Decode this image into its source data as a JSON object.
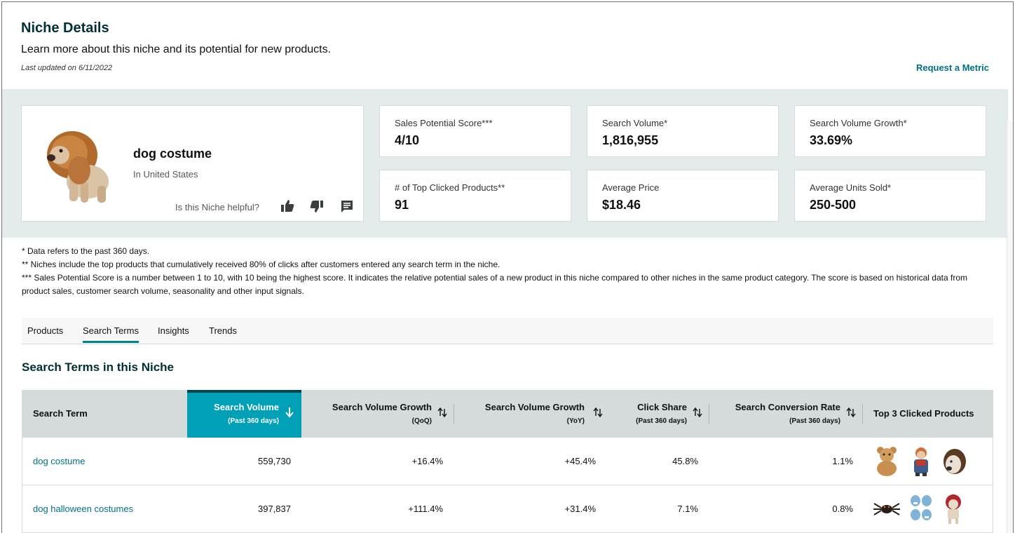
{
  "header": {
    "title": "Niche Details",
    "subtitle": "Learn more about this niche and its potential for new products.",
    "last_updated": "Last updated on 6/11/2022",
    "request_metric": "Request a Metric"
  },
  "niche": {
    "name": "dog costume",
    "market": "In United States",
    "helpful_prompt": "Is this Niche helpful?",
    "icons": [
      "thumbs-up-icon",
      "thumbs-down-icon",
      "comment-icon"
    ]
  },
  "metrics": [
    {
      "label": "Sales Potential Score***",
      "value": "4/10"
    },
    {
      "label": "Search Volume*",
      "value": "1,816,955"
    },
    {
      "label": "Search Volume Growth*",
      "value": "33.69%"
    },
    {
      "label": "# of Top Clicked Products**",
      "value": "91"
    },
    {
      "label": "Average Price",
      "value": "$18.46"
    },
    {
      "label": "Average Units Sold*",
      "value": "250-500"
    }
  ],
  "notes": [
    "* Data refers to the past 360 days.",
    "** Niches include the top products that cumulatively received 80% of clicks after customers entered any search term in the niche.",
    "*** Sales Potential Score is a number between 1 to 10, with 10 being the highest score. It indicates the relative potential sales of a new product in this niche compared to other niches in the same product category. The score is based on historical data from product sales, customer search volume, seasonality and other input signals."
  ],
  "tabs": [
    {
      "label": "Products",
      "active": false
    },
    {
      "label": "Search Terms",
      "active": true
    },
    {
      "label": "Insights",
      "active": false
    },
    {
      "label": "Trends",
      "active": false
    }
  ],
  "section_title": "Search Terms in this Niche",
  "table": {
    "columns": [
      {
        "label": "Search Term",
        "sub": ""
      },
      {
        "label": "Search Volume",
        "sub": "(Past 360 days)"
      },
      {
        "label": "Search Volume Growth",
        "sub": "(QoQ)"
      },
      {
        "label": "Search Volume Growth",
        "sub": "(YoY)"
      },
      {
        "label": "Click Share",
        "sub": "(Past 360 days)"
      },
      {
        "label": "Search Conversion Rate",
        "sub": "(Past 360 days)"
      },
      {
        "label": "Top 3 Clicked Products",
        "sub": ""
      }
    ],
    "rows": [
      {
        "term": "dog costume",
        "volume": "559,730",
        "growth_qoq": "+16.4%",
        "growth_yoy": "+45.4%",
        "click_share": "45.8%",
        "conversion": "1.1%",
        "products": [
          "teddy-bear-costume-thumbnail",
          "chucky-doll-costume-thumbnail",
          "wig-costume-thumbnail"
        ]
      },
      {
        "term": "dog halloween costumes",
        "volume": "397,837",
        "growth_qoq": "+111.4%",
        "growth_yoy": "+31.4%",
        "click_share": "7.1%",
        "conversion": "0.8%",
        "products": [
          "spider-costume-thumbnail",
          "shark-costume-set-thumbnail",
          "red-riding-hood-costume-thumbnail"
        ]
      }
    ]
  },
  "colors": {
    "accent": "#008296",
    "active_header": "#00a0b6",
    "link": "#007185",
    "band": "#e3ebeb",
    "title": "#002f36"
  }
}
